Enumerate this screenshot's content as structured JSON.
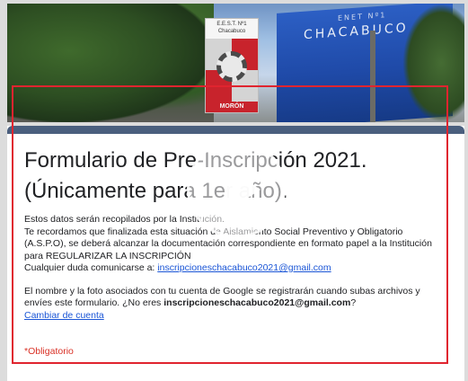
{
  "banner": {
    "building_sign_top": "ENET Nº1",
    "building_sign": "CHACABUCO",
    "logo_top": "E.E.S.T. Nº1 Chacabuco",
    "logo_bottom": "MORÓN"
  },
  "form": {
    "title": "Formulario de Pre-Inscripción 2021. (Únicamente para 1er año).",
    "para1": "Estos datos serán recopilados por la Institución.",
    "para2": "Te recordamos que finalizada esta situación de Aislamiento Social Preventivo y Obligatorio (A.S.P.O), se deberá alcanzar la documentación correspondiente en formato papel a la Institución para REGULARIZAR LA INSCRIPCIÓN",
    "para3_prefix": "Cualquier duda comunicarse a:",
    "contact_email": "inscripcioneschacabuco2021@gmail.com",
    "google_note": "El nombre y la foto asociados con tu cuenta de Google se registrarán cuando subas archivos y envíes este formulario. ¿No eres",
    "account_email": "inscripcioneschacabuco2021@gmail.com",
    "google_note_end": "?",
    "switch_account": "Cambiar de cuenta",
    "required_note": "*Obligatorio"
  },
  "colors": {
    "card_stripe": "#4a5f7e",
    "notice_border": "#e0242f",
    "link": "#1a55d6",
    "required": "#d93025"
  },
  "overlay": {
    "icon": "play-icon"
  }
}
